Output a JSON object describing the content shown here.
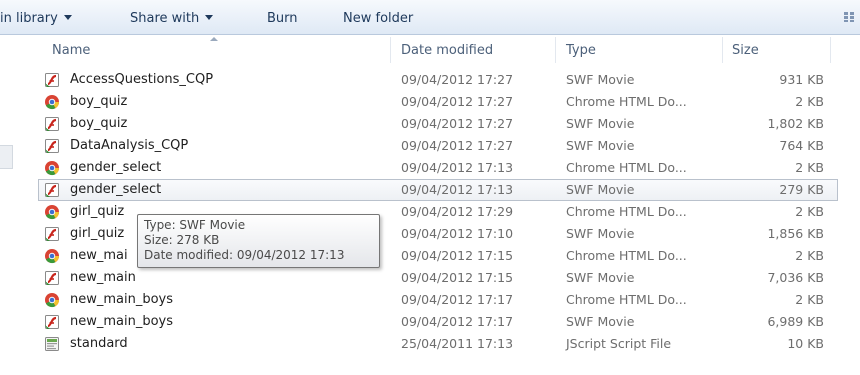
{
  "toolbar": {
    "include_in_library": "in library",
    "share_with": "Share with",
    "burn": "Burn",
    "new_folder": "New folder"
  },
  "columns": {
    "name": "Name",
    "date": "Date modified",
    "type": "Type",
    "size": "Size"
  },
  "files": [
    {
      "name": "AccessQuestions_CQP",
      "date": "09/04/2012 17:27",
      "type": "SWF Movie",
      "size": "931 KB",
      "icon": "swf-file-icon"
    },
    {
      "name": "boy_quiz",
      "date": "09/04/2012 17:27",
      "type": "Chrome HTML Do...",
      "size": "2 KB",
      "icon": "chrome-html-file-icon"
    },
    {
      "name": "boy_quiz",
      "date": "09/04/2012 17:27",
      "type": "SWF Movie",
      "size": "1,802 KB",
      "icon": "swf-file-icon"
    },
    {
      "name": "DataAnalysis_CQP",
      "date": "09/04/2012 17:27",
      "type": "SWF Movie",
      "size": "764 KB",
      "icon": "swf-file-icon"
    },
    {
      "name": "gender_select",
      "date": "09/04/2012 17:13",
      "type": "Chrome HTML Do...",
      "size": "2 KB",
      "icon": "chrome-html-file-icon"
    },
    {
      "name": "gender_select",
      "date": "09/04/2012 17:13",
      "type": "SWF Movie",
      "size": "279 KB",
      "icon": "swf-file-icon"
    },
    {
      "name": "girl_quiz",
      "date": "09/04/2012 17:29",
      "type": "Chrome HTML Do...",
      "size": "2 KB",
      "icon": "chrome-html-file-icon"
    },
    {
      "name": "girl_quiz",
      "date": "09/04/2012 17:10",
      "type": "SWF Movie",
      "size": "1,856 KB",
      "icon": "swf-file-icon"
    },
    {
      "name": "new_mai",
      "date": "09/04/2012 17:15",
      "type": "Chrome HTML Do...",
      "size": "2 KB",
      "icon": "chrome-html-file-icon"
    },
    {
      "name": "new_main",
      "date": "09/04/2012 17:15",
      "type": "SWF Movie",
      "size": "7,036 KB",
      "icon": "swf-file-icon"
    },
    {
      "name": "new_main_boys",
      "date": "09/04/2012 17:17",
      "type": "Chrome HTML Do...",
      "size": "2 KB",
      "icon": "chrome-html-file-icon"
    },
    {
      "name": "new_main_boys",
      "date": "09/04/2012 17:17",
      "type": "SWF Movie",
      "size": "6,989 KB",
      "icon": "swf-file-icon"
    },
    {
      "name": "standard",
      "date": "25/04/2011 17:13",
      "type": "JScript Script File",
      "size": "10 KB",
      "icon": "jscript-file-icon"
    }
  ],
  "selected_row": 5,
  "tooltip": {
    "type_line": "Type: SWF Movie",
    "size_line": "Size: 278 KB",
    "date_line": "Date modified: 09/04/2012 17:13"
  },
  "colors": {
    "selection_border": "#b9c1cc",
    "swf_red": "#c8251c",
    "chrome_green": "#3a9a3a",
    "chrome_yellow": "#f2c230",
    "chrome_red": "#d94333",
    "chrome_blue": "#3b6fd1"
  }
}
